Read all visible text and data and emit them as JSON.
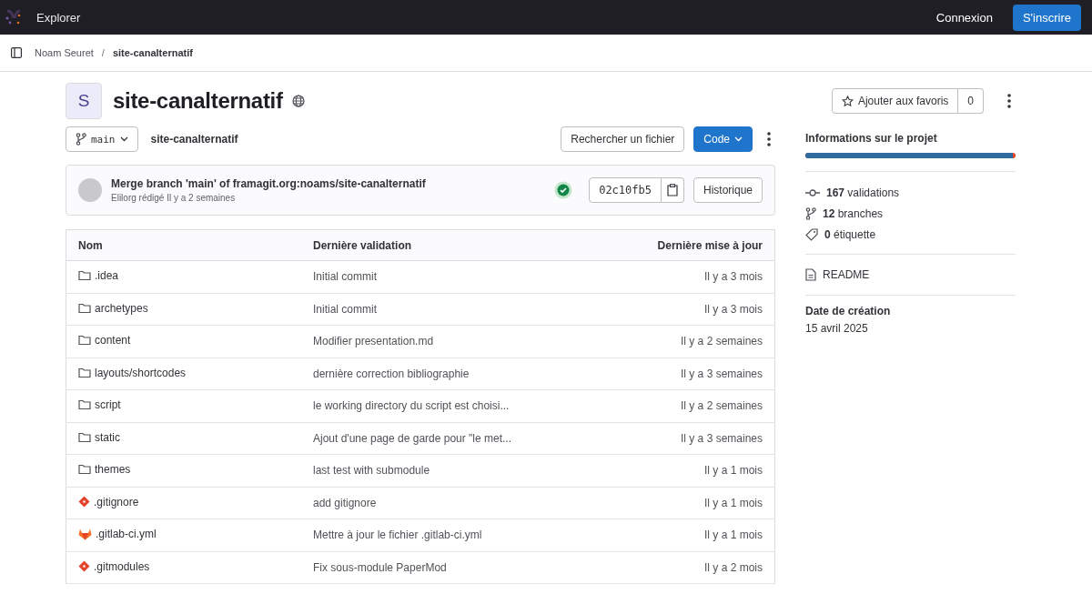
{
  "topbar": {
    "nav_label": "Explorer",
    "signin": "Connexion",
    "signup": "S'inscrire"
  },
  "breadcrumb": {
    "items": [
      "Noam Seuret",
      "site-canalternatif"
    ],
    "separator": "/"
  },
  "project": {
    "avatar_letter": "S",
    "name": "site-canalternatif",
    "star_label": "Ajouter aux favoris",
    "star_count": "0"
  },
  "toolbar": {
    "branch": "main",
    "path": "site-canalternatif",
    "find_file": "Rechercher un fichier",
    "code_button": "Code"
  },
  "last_commit": {
    "title": "Merge branch 'main' of framagit.org:noams/site-canalternatif",
    "meta": "Elilorg rédigé Il y a 2 semaines",
    "pipeline_passed": true,
    "sha": "02c10fb5",
    "history": "Historique"
  },
  "table": {
    "columns": [
      "Nom",
      "Dernière validation",
      "Dernière mise à jour"
    ],
    "rows": [
      {
        "kind": "folder",
        "name": ".idea",
        "commit": "Initial commit",
        "updated": "Il y a 3 mois"
      },
      {
        "kind": "folder",
        "name": "archetypes",
        "commit": "Initial commit",
        "updated": "Il y a 3 mois"
      },
      {
        "kind": "folder",
        "name": "content",
        "commit": "Modifier presentation.md",
        "updated": "Il y a 2 semaines"
      },
      {
        "kind": "folder",
        "name": "layouts/shortcodes",
        "commit": "dernière correction bibliographie",
        "updated": "Il y a 3 semaines"
      },
      {
        "kind": "folder",
        "name": "script",
        "commit": "le working directory du script est choisi...",
        "updated": "Il y a 2 semaines"
      },
      {
        "kind": "folder",
        "name": "static",
        "commit": "Ajout d'une page de garde pour \"le met...",
        "updated": "Il y a 3 semaines"
      },
      {
        "kind": "folder",
        "name": "themes",
        "commit": "last test with submodule",
        "updated": "Il y a 1 mois"
      },
      {
        "kind": "git",
        "name": ".gitignore",
        "commit": "add gitignore",
        "updated": "Il y a 1 mois"
      },
      {
        "kind": "gitlab",
        "name": ".gitlab-ci.yml",
        "commit": "Mettre à jour le fichier .gitlab-ci.yml",
        "updated": "Il y a 1 mois"
      },
      {
        "kind": "git",
        "name": ".gitmodules",
        "commit": "Fix sous-module PaperMod",
        "updated": "Il y a 2 mois"
      }
    ]
  },
  "sidebar": {
    "title": "Informations sur le projet",
    "language_bar": {
      "level": 0.985
    },
    "stats": [
      {
        "kind": "commit",
        "text": "**167** validations"
      },
      {
        "kind": "branch",
        "text": "**12** branches"
      },
      {
        "kind": "tag",
        "text": "**0** étiquette"
      }
    ],
    "readme": "README",
    "created_label": "Date de création",
    "created_date": "15 avril 2025"
  }
}
